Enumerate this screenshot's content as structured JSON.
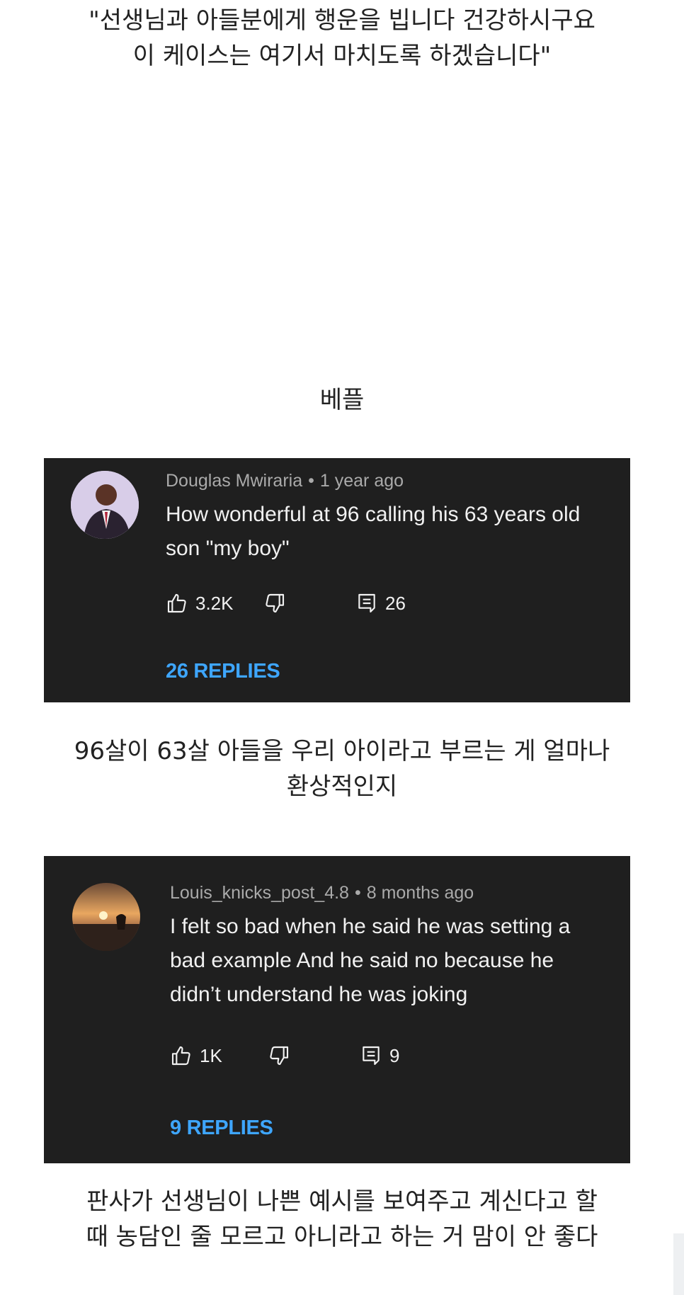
{
  "quote": {
    "line1": "\"선생님과 아들분에게 행운을 빕니다 건강하시구요",
    "line2": "이 케이스는 여기서 마치도록 하겠습니다\""
  },
  "section_heading": "베플",
  "comments": [
    {
      "author": "Douglas Mwiraria",
      "separator": "•",
      "time": "1 year ago",
      "text_lines": [
        "How wonderful at 96 calling his 63 years old",
        "son \"my boy\""
      ],
      "likes": "3.2K",
      "reply_count": "26",
      "replies_label": "26 REPLIES"
    },
    {
      "author": "Louis_knicks_post_4.8",
      "separator": "•",
      "time": "8 months ago",
      "text_lines": [
        "I felt so bad when he said he was setting a",
        "bad example And he said no because he",
        "didn’t understand he was joking"
      ],
      "likes": "1K",
      "reply_count": "9",
      "replies_label": "9 REPLIES"
    }
  ],
  "translations": [
    {
      "line1": "96살이 63살 아들을 우리 아이라고 부르는 게 얼마나",
      "line2": "환상적인지"
    },
    {
      "line1": "판사가 선생님이 나쁜 예시를 보여주고 계신다고 할",
      "line2": "때 농담인 줄 모르고 아니라고 하는 거 맘이 안 좋다"
    }
  ],
  "icons": {
    "like": "thumbs-up-icon",
    "dislike": "thumbs-down-icon",
    "reply": "reply-comment-icon"
  },
  "colors": {
    "card_background": "#1f1f1f",
    "meta_text": "#aaaaaa",
    "replies_link": "#3ea6ff",
    "page_background": "#ffffff"
  }
}
